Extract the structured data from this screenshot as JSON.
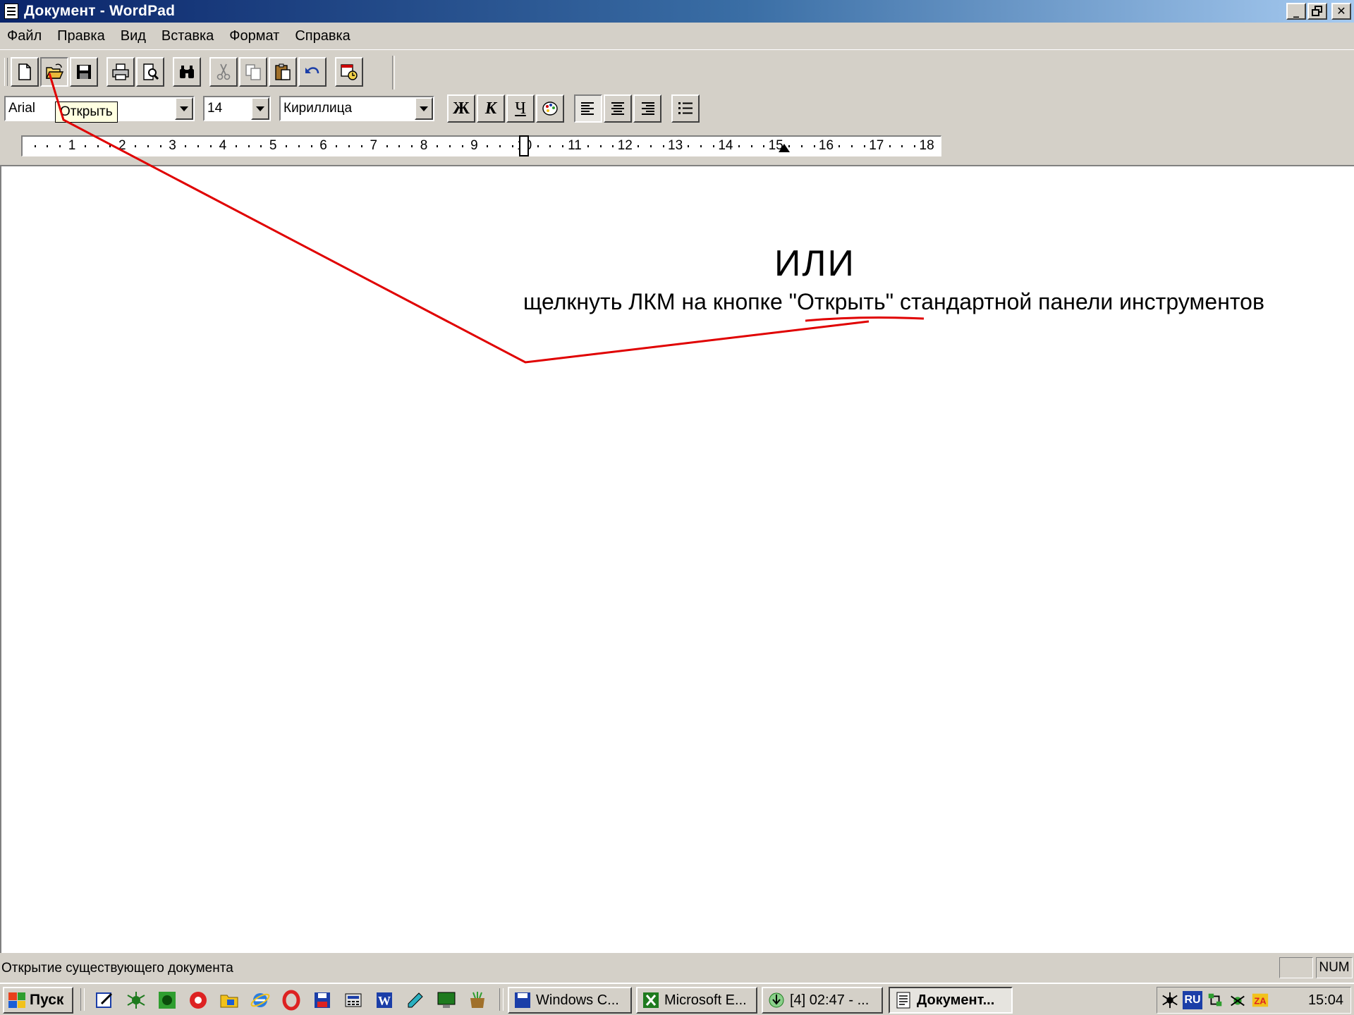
{
  "window": {
    "title": "Документ - WordPad",
    "min_glyph": "_",
    "max_glyph": "🗗",
    "close_glyph": "✕"
  },
  "menu": [
    "Файл",
    "Правка",
    "Вид",
    "Вставка",
    "Формат",
    "Справка"
  ],
  "toolbar": {
    "buttons": [
      "new-document",
      "open",
      "save",
      "print",
      "print-preview",
      "find",
      "cut",
      "copy",
      "paste",
      "undo",
      "insert-date-time"
    ],
    "tooltip": "Открыть"
  },
  "format_bar": {
    "font": "Arial",
    "size": "14",
    "script": "Кириллица",
    "bold_label": "Ж",
    "italic_label": "К",
    "underline_label": "Ч"
  },
  "ruler": {
    "numbers": [
      "1",
      "2",
      "3",
      "4",
      "5",
      "6",
      "7",
      "8",
      "9",
      "10",
      "11",
      "12",
      "13",
      "14",
      "15",
      "16",
      "17",
      "18"
    ]
  },
  "document": {
    "heading": "ИЛИ",
    "instruction_before": "щелкнуть ЛКМ на кнопке ",
    "instruction_highlight": "\"Открыть\"",
    "instruction_after": " стандартной панели инструментов"
  },
  "annotation": {
    "color": "#e00000"
  },
  "status": {
    "text": "Открытие существующего документа",
    "num": "NUM"
  },
  "taskbar": {
    "start_label": "Пуск",
    "quick_launch": [
      "edit-icon",
      "spider-icon",
      "green-app-icon",
      "red-circle-icon",
      "folder-icon",
      "ie-icon",
      "opera-icon",
      "floppy-icon",
      "calculator-icon",
      "word-icon",
      "note-icon",
      "monitor-icon",
      "desk-icon"
    ],
    "tasks": [
      "Windows C...",
      "Microsoft E...",
      "[4] 02:47 - ...",
      "Документ..."
    ],
    "lang": "RU",
    "clock": "15:04"
  }
}
